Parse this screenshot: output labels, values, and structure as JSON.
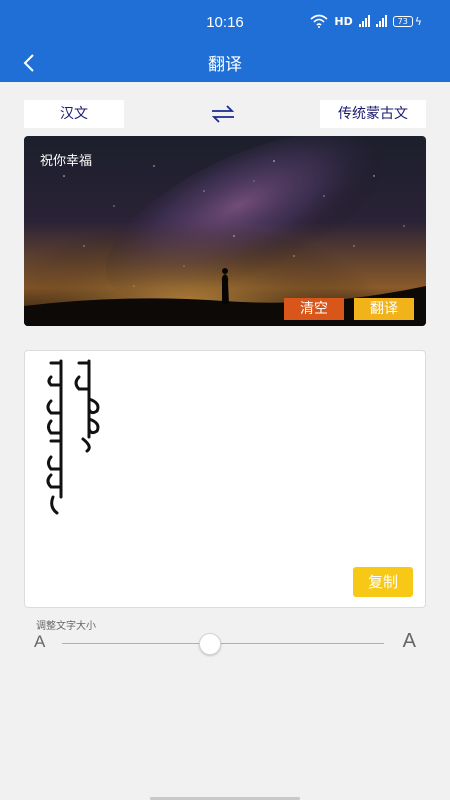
{
  "status_bar": {
    "time": "10:16",
    "network": "HD",
    "signal_1": "5G",
    "signal_2": "4G",
    "battery": "73"
  },
  "nav": {
    "title": "翻译",
    "back_icon": "chevron-left-icon"
  },
  "languages": {
    "source": "汉文",
    "target": "传统蒙古文",
    "swap_icon": "swap-arrows-icon"
  },
  "input": {
    "text": "祝你幸福",
    "clear_label": "清空",
    "translate_label": "翻译"
  },
  "output": {
    "copy_label": "复制"
  },
  "font_size": {
    "label": "调整文字大小",
    "small_marker": "A",
    "large_marker": "A",
    "level": 0.46
  },
  "colors": {
    "primary": "#1f6fd6",
    "clear": "#d8561a",
    "translate": "#f1b21a",
    "copy": "#f7c815"
  }
}
